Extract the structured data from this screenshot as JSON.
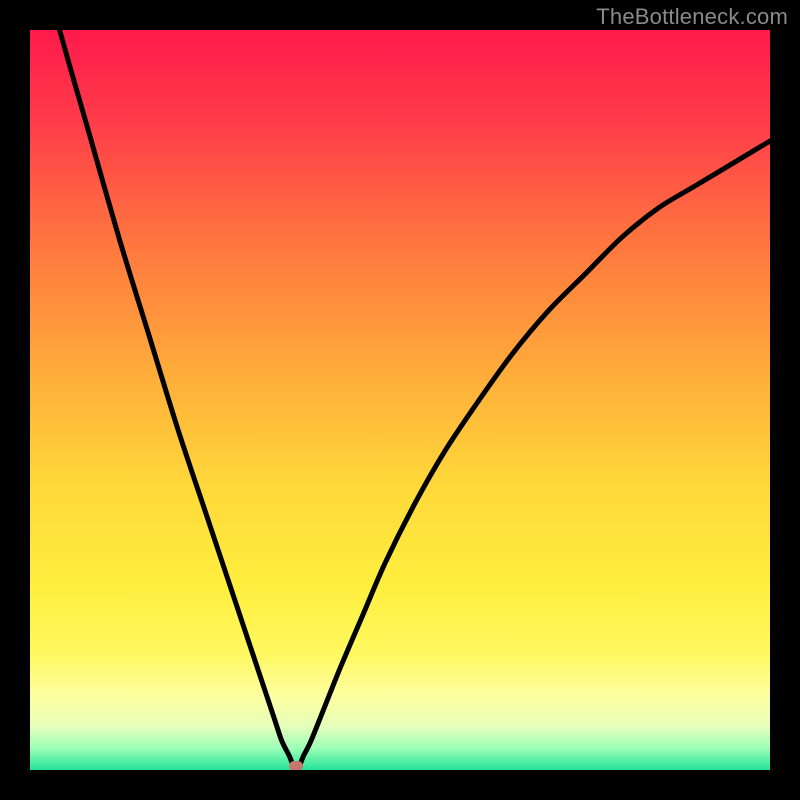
{
  "watermark": "TheBottleneck.com",
  "colors": {
    "marker": "#c8776d",
    "curve": "#000000"
  },
  "chart_data": {
    "type": "line",
    "title": "",
    "xlabel": "",
    "ylabel": "",
    "xlim": [
      0,
      100
    ],
    "ylim": [
      0,
      100
    ],
    "optimal_x": 36,
    "series": [
      {
        "name": "bottleneck",
        "x": [
          0,
          4,
          8,
          12,
          16,
          20,
          24,
          28,
          30,
          32,
          33,
          34,
          35,
          36,
          37,
          38,
          40,
          42,
          45,
          48,
          52,
          56,
          60,
          65,
          70,
          75,
          80,
          85,
          90,
          95,
          100
        ],
        "y": [
          115,
          100,
          86,
          72,
          59,
          46,
          34,
          22,
          16,
          10,
          7,
          4,
          2,
          0,
          2,
          4,
          9,
          14,
          21,
          28,
          36,
          43,
          49,
          56,
          62,
          67,
          72,
          76,
          79,
          82,
          85
        ]
      }
    ]
  }
}
